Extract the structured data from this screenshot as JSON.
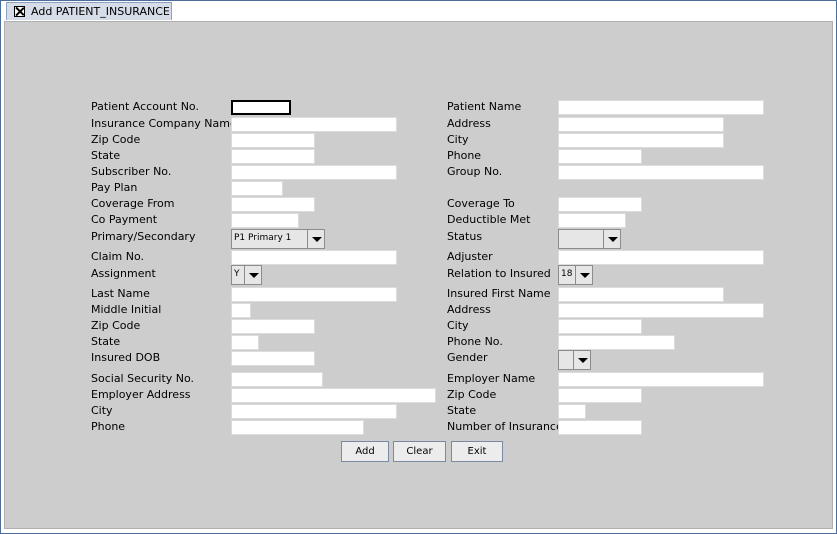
{
  "window": {
    "tab_title": "Add PATIENT_INSURANCE"
  },
  "form": {
    "left": [
      {
        "label": "Patient Account No.",
        "type": "text",
        "value": ""
      },
      {
        "label": "Insurance Company Name",
        "type": "text",
        "value": ""
      },
      {
        "label": "Zip Code",
        "type": "text",
        "value": ""
      },
      {
        "label": "State",
        "type": "text",
        "value": ""
      },
      {
        "label": "Subscriber No.",
        "type": "text",
        "value": ""
      },
      {
        "label": "Pay Plan",
        "type": "text",
        "value": ""
      },
      {
        "label": "Coverage From",
        "type": "text",
        "value": ""
      },
      {
        "label": "Co Payment",
        "type": "text",
        "value": ""
      },
      {
        "label": "Primary/Secondary",
        "type": "select",
        "value": "P1 Primary 1"
      },
      {
        "label": "Claim No.",
        "type": "text",
        "value": ""
      },
      {
        "label": "Assignment",
        "type": "select",
        "value": "Y"
      },
      {
        "label": "Last Name",
        "type": "text",
        "value": ""
      },
      {
        "label": "Middle Initial",
        "type": "text",
        "value": ""
      },
      {
        "label": "Zip Code",
        "type": "text",
        "value": ""
      },
      {
        "label": "State",
        "type": "text",
        "value": ""
      },
      {
        "label": "Insured DOB",
        "type": "text",
        "value": ""
      },
      {
        "label": "Social Security No.",
        "type": "text",
        "value": ""
      },
      {
        "label": "Employer Address",
        "type": "text",
        "value": ""
      },
      {
        "label": "City",
        "type": "text",
        "value": ""
      },
      {
        "label": "Phone",
        "type": "text",
        "value": ""
      }
    ],
    "right": [
      {
        "label": "Patient Name",
        "type": "text",
        "value": ""
      },
      {
        "label": "Address",
        "type": "text",
        "value": ""
      },
      {
        "label": "City",
        "type": "text",
        "value": ""
      },
      {
        "label": "Phone",
        "type": "text",
        "value": ""
      },
      {
        "label": "Group No.",
        "type": "text",
        "value": ""
      },
      {
        "label": "Coverage To",
        "type": "text",
        "value": ""
      },
      {
        "label": "Deductible Met",
        "type": "text",
        "value": ""
      },
      {
        "label": "Status",
        "type": "select",
        "value": ""
      },
      {
        "label": "Adjuster",
        "type": "text",
        "value": ""
      },
      {
        "label": "Relation to Insured",
        "type": "select",
        "value": "18"
      },
      {
        "label": "Insured First Name",
        "type": "text",
        "value": ""
      },
      {
        "label": "Address",
        "type": "text",
        "value": ""
      },
      {
        "label": "City",
        "type": "text",
        "value": ""
      },
      {
        "label": "Phone No.",
        "type": "text",
        "value": ""
      },
      {
        "label": "Gender",
        "type": "select",
        "value": ""
      },
      {
        "label": "Employer Name",
        "type": "text",
        "value": ""
      },
      {
        "label": "Zip Code",
        "type": "text",
        "value": ""
      },
      {
        "label": "State",
        "type": "text",
        "value": ""
      },
      {
        "label": "Number of Insurance",
        "type": "text",
        "value": ""
      }
    ]
  },
  "buttons": {
    "add": "Add",
    "clear": "Clear",
    "exit": "Exit"
  }
}
